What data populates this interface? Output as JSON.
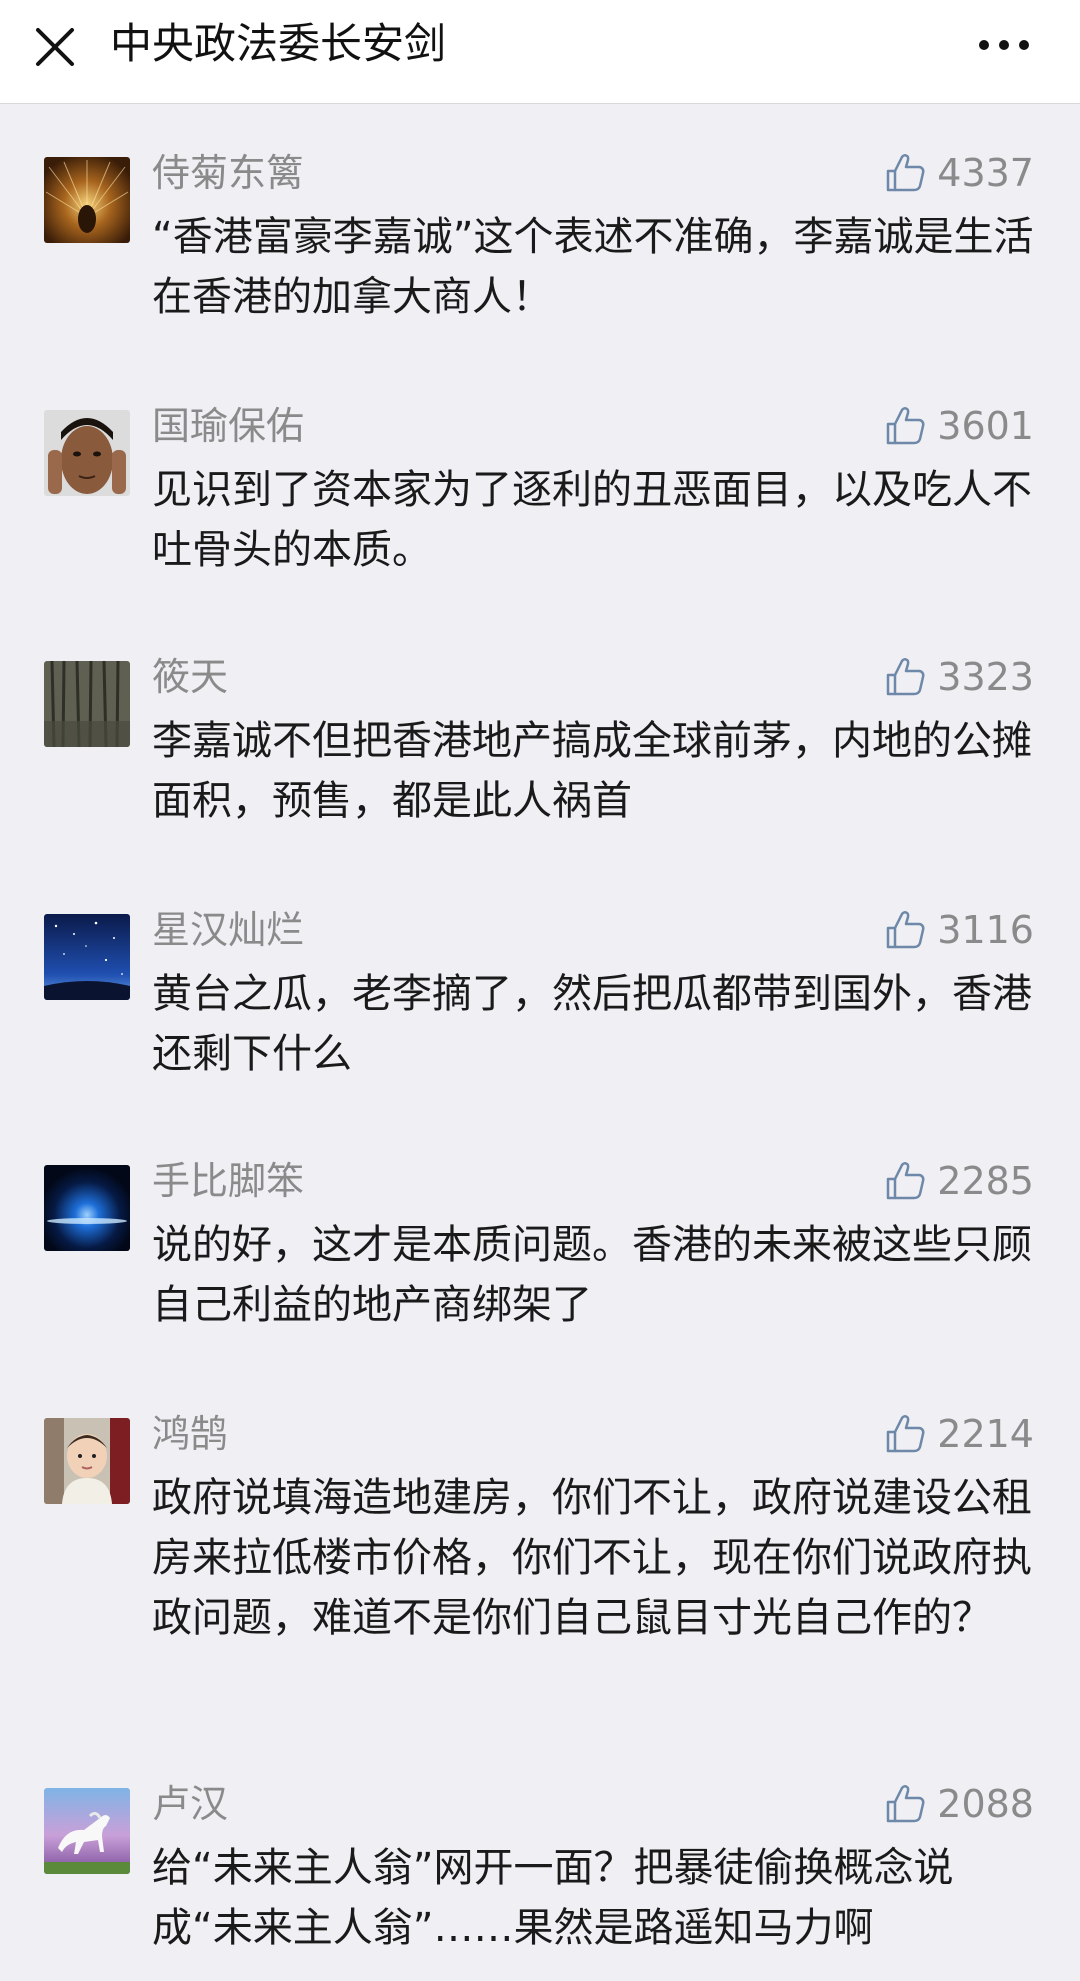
{
  "header": {
    "title": "中央政法委长安剑",
    "close_icon": "close-icon",
    "more_icon": "more-dots-icon"
  },
  "comments": [
    {
      "nickname": "侍菊东篱",
      "likes": "4337",
      "text": "“香港富豪李嘉诚”这个表述不准确，李嘉诚是生活在香港的加拿大商人！",
      "avatar": "peacock-avatar"
    },
    {
      "nickname": "国瑜保佑",
      "likes": "3601",
      "text": "见识到了资本家为了逐利的丑恶面目，以及吃人不吐骨头的本质。",
      "avatar": "man-portrait-avatar"
    },
    {
      "nickname": "筱天",
      "likes": "3323",
      "text": "李嘉诚不但把香港地产搞成全球前茅，内地的公摊面积，预售，都是此人祸首",
      "avatar": "forest-avatar"
    },
    {
      "nickname": "星汉灿烂",
      "likes": "3116",
      "text": "黄台之瓜，老李摘了，然后把瓜都带到国外，香港还剩下什么",
      "avatar": "starry-sky-avatar"
    },
    {
      "nickname": "手比脚笨",
      "likes": "2285",
      "text": "说的好，这才是本质问题。香港的未来被这些只顾自己利益的地产商绑架了",
      "avatar": "blue-horizon-avatar"
    },
    {
      "nickname": "鸿鹄",
      "likes": "2214",
      "text": "政府说填海造地建房，你们不让，政府说建设公租房来拉低楼市价格，你们不让，现在你们说政府执政问题，难道不是你们自己鼠目寸光自己作的？",
      "avatar": "baby-avatar"
    },
    {
      "nickname": "卢汉",
      "likes": "2088",
      "text": "给“未来主人翁”网开一面？把暴徒偷换概念说成“未来主人翁”……果然是路遥知马力啊",
      "avatar": "white-horse-avatar"
    }
  ],
  "colors": {
    "background": "#efeff4",
    "header_bg": "#ffffff",
    "nickname": "#8a8a8a",
    "text": "#1a1a1a"
  }
}
